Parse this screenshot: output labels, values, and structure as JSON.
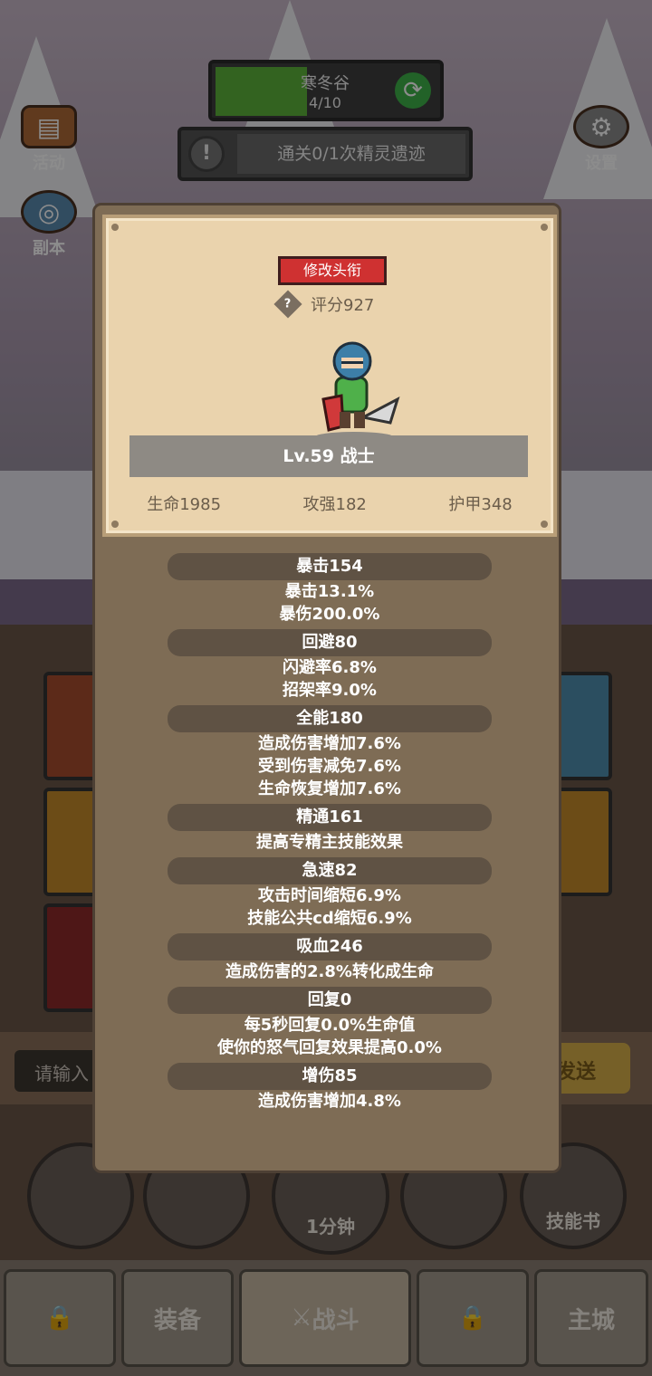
{
  "hud": {
    "stage_name": "寒冬谷",
    "stage_progress": "4/10",
    "stage_fill_fraction": 0.4,
    "quest_text": "通关0/1次精灵遗迹",
    "left_menu": [
      {
        "label": "活动",
        "icon": "chest-icon"
      },
      {
        "label": "副本",
        "icon": "portal-icon"
      }
    ],
    "settings_label": "设置",
    "chat_placeholder": "请输入",
    "send_label": "发送"
  },
  "bottom_nav": {
    "round_buttons": [
      "",
      "",
      "1分钟",
      "",
      "技能书"
    ],
    "tabs": [
      "",
      "装备",
      "战斗",
      "",
      "主城"
    ]
  },
  "profile": {
    "rename_button": "修改头衔",
    "rating_label": "评分927",
    "level_title": "Lv.59 战士",
    "hp": "生命1985",
    "attack": "攻强182",
    "armor": "护甲348"
  },
  "attributes": [
    {
      "name": "暴击154",
      "lines": [
        "暴击13.1%",
        "暴伤200.0%"
      ]
    },
    {
      "name": "回避80",
      "lines": [
        "闪避率6.8%",
        "招架率9.0%"
      ]
    },
    {
      "name": "全能180",
      "lines": [
        "造成伤害增加7.6%",
        "受到伤害减免7.6%",
        "生命恢复增加7.6%"
      ]
    },
    {
      "name": "精通161",
      "lines": [
        "提高专精主技能效果"
      ]
    },
    {
      "name": "急速82",
      "lines": [
        "攻击时间缩短6.9%",
        "技能公共cd缩短6.9%"
      ]
    },
    {
      "name": "吸血246",
      "lines": [
        "造成伤害的2.8%转化成生命"
      ]
    },
    {
      "name": "回复0",
      "lines": [
        "每5秒回复0.0%生命值",
        "使你的怒气回复效果提高0.0%"
      ]
    },
    {
      "name": "增伤85",
      "lines": [
        "造成伤害增加4.8%"
      ]
    }
  ]
}
